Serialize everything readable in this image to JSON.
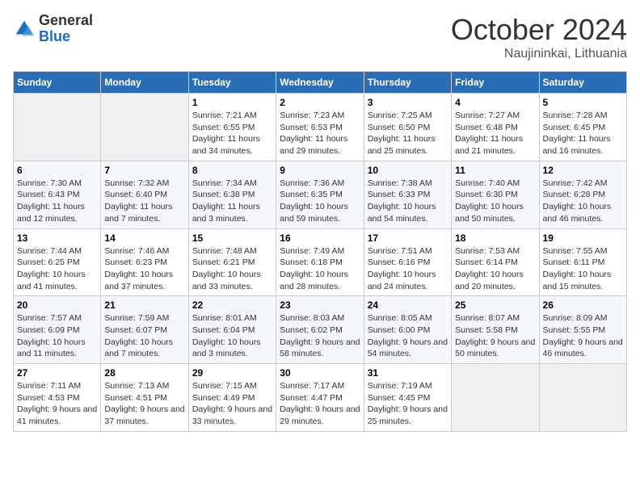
{
  "header": {
    "logo_general": "General",
    "logo_blue": "Blue",
    "month": "October 2024",
    "location": "Naujininkai, Lithuania"
  },
  "weekdays": [
    "Sunday",
    "Monday",
    "Tuesday",
    "Wednesday",
    "Thursday",
    "Friday",
    "Saturday"
  ],
  "weeks": [
    [
      {
        "day": "",
        "sunrise": "",
        "sunset": "",
        "daylight": ""
      },
      {
        "day": "",
        "sunrise": "",
        "sunset": "",
        "daylight": ""
      },
      {
        "day": "1",
        "sunrise": "Sunrise: 7:21 AM",
        "sunset": "Sunset: 6:55 PM",
        "daylight": "Daylight: 11 hours and 34 minutes."
      },
      {
        "day": "2",
        "sunrise": "Sunrise: 7:23 AM",
        "sunset": "Sunset: 6:53 PM",
        "daylight": "Daylight: 11 hours and 29 minutes."
      },
      {
        "day": "3",
        "sunrise": "Sunrise: 7:25 AM",
        "sunset": "Sunset: 6:50 PM",
        "daylight": "Daylight: 11 hours and 25 minutes."
      },
      {
        "day": "4",
        "sunrise": "Sunrise: 7:27 AM",
        "sunset": "Sunset: 6:48 PM",
        "daylight": "Daylight: 11 hours and 21 minutes."
      },
      {
        "day": "5",
        "sunrise": "Sunrise: 7:28 AM",
        "sunset": "Sunset: 6:45 PM",
        "daylight": "Daylight: 11 hours and 16 minutes."
      }
    ],
    [
      {
        "day": "6",
        "sunrise": "Sunrise: 7:30 AM",
        "sunset": "Sunset: 6:43 PM",
        "daylight": "Daylight: 11 hours and 12 minutes."
      },
      {
        "day": "7",
        "sunrise": "Sunrise: 7:32 AM",
        "sunset": "Sunset: 6:40 PM",
        "daylight": "Daylight: 11 hours and 7 minutes."
      },
      {
        "day": "8",
        "sunrise": "Sunrise: 7:34 AM",
        "sunset": "Sunset: 6:38 PM",
        "daylight": "Daylight: 11 hours and 3 minutes."
      },
      {
        "day": "9",
        "sunrise": "Sunrise: 7:36 AM",
        "sunset": "Sunset: 6:35 PM",
        "daylight": "Daylight: 10 hours and 59 minutes."
      },
      {
        "day": "10",
        "sunrise": "Sunrise: 7:38 AM",
        "sunset": "Sunset: 6:33 PM",
        "daylight": "Daylight: 10 hours and 54 minutes."
      },
      {
        "day": "11",
        "sunrise": "Sunrise: 7:40 AM",
        "sunset": "Sunset: 6:30 PM",
        "daylight": "Daylight: 10 hours and 50 minutes."
      },
      {
        "day": "12",
        "sunrise": "Sunrise: 7:42 AM",
        "sunset": "Sunset: 6:28 PM",
        "daylight": "Daylight: 10 hours and 46 minutes."
      }
    ],
    [
      {
        "day": "13",
        "sunrise": "Sunrise: 7:44 AM",
        "sunset": "Sunset: 6:25 PM",
        "daylight": "Daylight: 10 hours and 41 minutes."
      },
      {
        "day": "14",
        "sunrise": "Sunrise: 7:46 AM",
        "sunset": "Sunset: 6:23 PM",
        "daylight": "Daylight: 10 hours and 37 minutes."
      },
      {
        "day": "15",
        "sunrise": "Sunrise: 7:48 AM",
        "sunset": "Sunset: 6:21 PM",
        "daylight": "Daylight: 10 hours and 33 minutes."
      },
      {
        "day": "16",
        "sunrise": "Sunrise: 7:49 AM",
        "sunset": "Sunset: 6:18 PM",
        "daylight": "Daylight: 10 hours and 28 minutes."
      },
      {
        "day": "17",
        "sunrise": "Sunrise: 7:51 AM",
        "sunset": "Sunset: 6:16 PM",
        "daylight": "Daylight: 10 hours and 24 minutes."
      },
      {
        "day": "18",
        "sunrise": "Sunrise: 7:53 AM",
        "sunset": "Sunset: 6:14 PM",
        "daylight": "Daylight: 10 hours and 20 minutes."
      },
      {
        "day": "19",
        "sunrise": "Sunrise: 7:55 AM",
        "sunset": "Sunset: 6:11 PM",
        "daylight": "Daylight: 10 hours and 15 minutes."
      }
    ],
    [
      {
        "day": "20",
        "sunrise": "Sunrise: 7:57 AM",
        "sunset": "Sunset: 6:09 PM",
        "daylight": "Daylight: 10 hours and 11 minutes."
      },
      {
        "day": "21",
        "sunrise": "Sunrise: 7:59 AM",
        "sunset": "Sunset: 6:07 PM",
        "daylight": "Daylight: 10 hours and 7 minutes."
      },
      {
        "day": "22",
        "sunrise": "Sunrise: 8:01 AM",
        "sunset": "Sunset: 6:04 PM",
        "daylight": "Daylight: 10 hours and 3 minutes."
      },
      {
        "day": "23",
        "sunrise": "Sunrise: 8:03 AM",
        "sunset": "Sunset: 6:02 PM",
        "daylight": "Daylight: 9 hours and 58 minutes."
      },
      {
        "day": "24",
        "sunrise": "Sunrise: 8:05 AM",
        "sunset": "Sunset: 6:00 PM",
        "daylight": "Daylight: 9 hours and 54 minutes."
      },
      {
        "day": "25",
        "sunrise": "Sunrise: 8:07 AM",
        "sunset": "Sunset: 5:58 PM",
        "daylight": "Daylight: 9 hours and 50 minutes."
      },
      {
        "day": "26",
        "sunrise": "Sunrise: 8:09 AM",
        "sunset": "Sunset: 5:55 PM",
        "daylight": "Daylight: 9 hours and 46 minutes."
      }
    ],
    [
      {
        "day": "27",
        "sunrise": "Sunrise: 7:11 AM",
        "sunset": "Sunset: 4:53 PM",
        "daylight": "Daylight: 9 hours and 41 minutes."
      },
      {
        "day": "28",
        "sunrise": "Sunrise: 7:13 AM",
        "sunset": "Sunset: 4:51 PM",
        "daylight": "Daylight: 9 hours and 37 minutes."
      },
      {
        "day": "29",
        "sunrise": "Sunrise: 7:15 AM",
        "sunset": "Sunset: 4:49 PM",
        "daylight": "Daylight: 9 hours and 33 minutes."
      },
      {
        "day": "30",
        "sunrise": "Sunrise: 7:17 AM",
        "sunset": "Sunset: 4:47 PM",
        "daylight": "Daylight: 9 hours and 29 minutes."
      },
      {
        "day": "31",
        "sunrise": "Sunrise: 7:19 AM",
        "sunset": "Sunset: 4:45 PM",
        "daylight": "Daylight: 9 hours and 25 minutes."
      },
      {
        "day": "",
        "sunrise": "",
        "sunset": "",
        "daylight": ""
      },
      {
        "day": "",
        "sunrise": "",
        "sunset": "",
        "daylight": ""
      }
    ]
  ]
}
